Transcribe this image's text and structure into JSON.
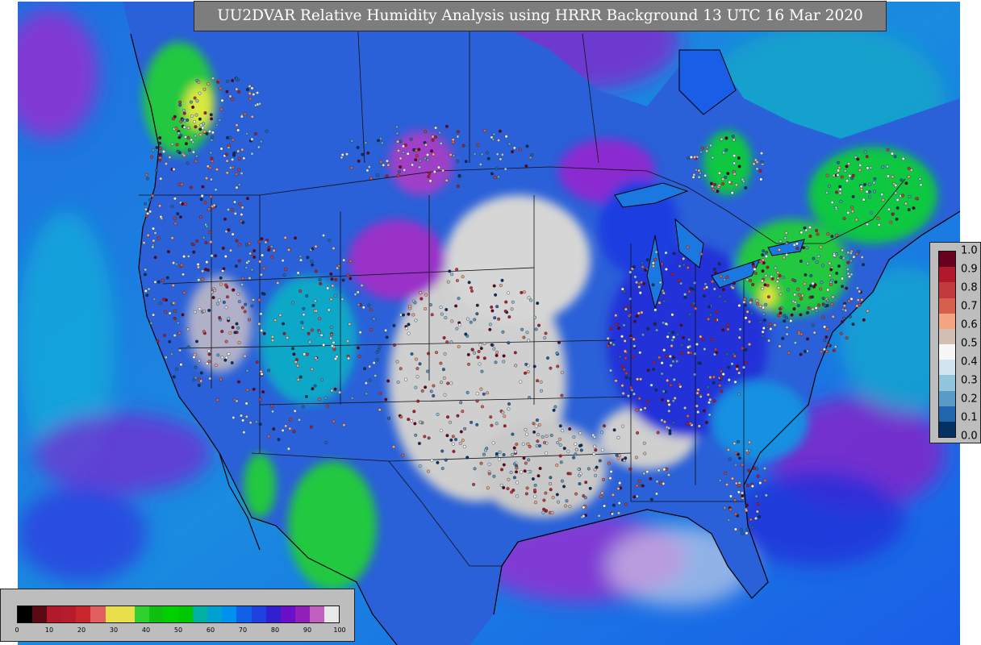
{
  "title": "UU2DVAR Relative Humidity Analysis using HRRR Background 13 UTC 16 Mar 2020",
  "obs_legend": {
    "ticks": [
      "1.0",
      "0.9",
      "0.8",
      "0.7",
      "0.6",
      "0.5",
      "0.4",
      "0.3",
      "0.2",
      "0.1",
      "0.0"
    ],
    "colors_top_to_bottom": [
      "#67001f",
      "#b2182b",
      "#c33a3e",
      "#d6604d",
      "#f4a582",
      "#d2c0b7",
      "#f7f7f7",
      "#d1e5f0",
      "#92c5de",
      "#5a9bc8",
      "#2166ac",
      "#053061"
    ]
  },
  "rh_legend": {
    "ticks": [
      "0",
      "10",
      "20",
      "30",
      "40",
      "50",
      "60",
      "70",
      "80",
      "90",
      "100"
    ],
    "colors": [
      "#000000",
      "#5a0a14",
      "#b01a2a",
      "#b71c2c",
      "#c9262d",
      "#e06060",
      "#e8e04a",
      "#e8e04a",
      "#30d030",
      "#10c010",
      "#00d000",
      "#00c800",
      "#00b0a0",
      "#00a0d0",
      "#0090f0",
      "#1060e8",
      "#2040e0",
      "#3020d0",
      "#6a10c8",
      "#9020b8",
      "#c060c0",
      "#e8e8e8"
    ]
  },
  "map_colors": {
    "ocean_blue": "#1a78e0",
    "deep_blue": "#2030d8",
    "purple": "#8a2ad0",
    "gray_dry": "#cfcfcf",
    "green": "#22c840",
    "border": "#111111"
  }
}
